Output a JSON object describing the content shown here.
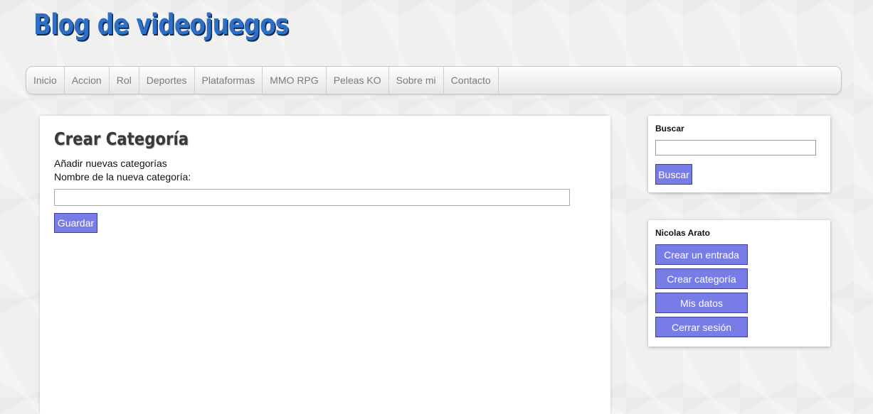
{
  "site": {
    "title": "Blog de videojuegos"
  },
  "nav": {
    "items": [
      "Inicio",
      "Accion",
      "Rol",
      "Deportes",
      "Plataformas",
      "MMO RPG",
      "Peleas KO",
      "Sobre mi",
      "Contacto"
    ]
  },
  "main": {
    "title": "Crear Categoría",
    "subtitle": "Añadir nuevas categorías",
    "field_label": "Nombre de la nueva categoría:",
    "field_value": "",
    "save_label": "Guardar"
  },
  "search": {
    "title": "Buscar",
    "value": "",
    "button_label": "Buscar"
  },
  "user": {
    "name": "Nicolas Arato",
    "actions": [
      "Crear un entrada",
      "Crear categoría",
      "Mis datos",
      "Cerrar sesión"
    ]
  },
  "colors": {
    "accent_button": "#787ce6",
    "title_blue": "#2d6fc4",
    "background": "#f0f0f0"
  }
}
